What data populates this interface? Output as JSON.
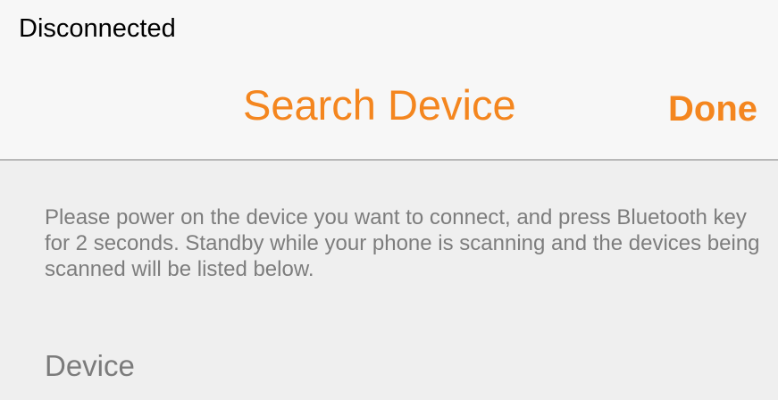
{
  "status_bar": {
    "connection_status": "Disconnected"
  },
  "nav_bar": {
    "title": "Search Device",
    "done_label": "Done"
  },
  "content": {
    "instructions": "Please power on the device you want to connect, and press Bluetooth key for 2 seconds. Standby while your phone is scanning and the devices being scanned will be listed below.",
    "section_header": "Device"
  },
  "colors": {
    "accent": "#f4861f",
    "background": "#efefef",
    "bar_background": "#f7f7f7",
    "secondary_text": "#7d7d7d",
    "divider": "#b8b8b8"
  }
}
